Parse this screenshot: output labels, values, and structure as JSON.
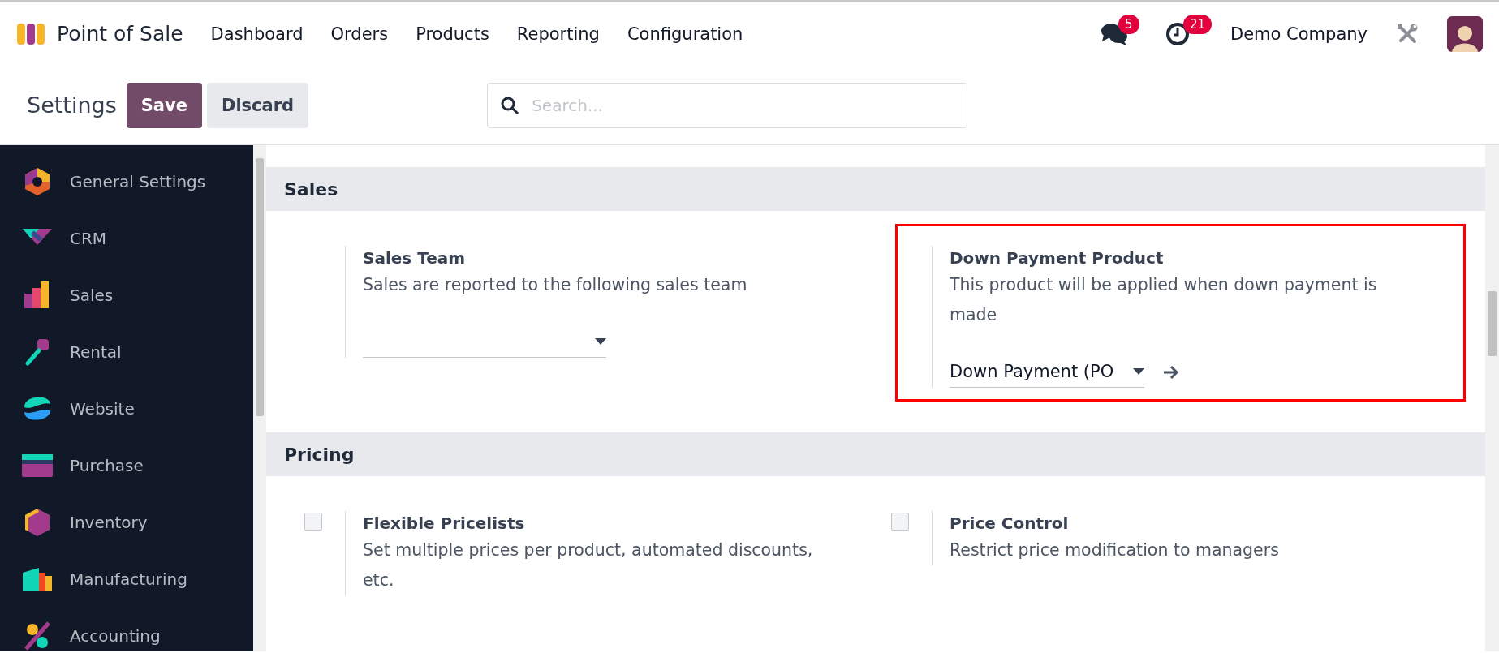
{
  "navbar": {
    "app_name": "Point of Sale",
    "menu": [
      "Dashboard",
      "Orders",
      "Products",
      "Reporting",
      "Configuration"
    ],
    "messages_badge": "5",
    "activities_badge": "21",
    "company": "Demo Company"
  },
  "control_panel": {
    "title": "Settings",
    "save": "Save",
    "discard": "Discard",
    "search": {
      "placeholder": "Search..."
    }
  },
  "sidebar": {
    "items": [
      {
        "label": "General Settings",
        "kind": "general"
      },
      {
        "label": "CRM",
        "kind": "crm"
      },
      {
        "label": "Sales",
        "kind": "sales"
      },
      {
        "label": "Rental",
        "kind": "rental"
      },
      {
        "label": "Website",
        "kind": "website"
      },
      {
        "label": "Purchase",
        "kind": "purchase"
      },
      {
        "label": "Inventory",
        "kind": "inventory"
      },
      {
        "label": "Manufacturing",
        "kind": "manufacturing"
      },
      {
        "label": "Accounting",
        "kind": "accounting"
      }
    ]
  },
  "sections": [
    {
      "title": "Sales",
      "settings": [
        {
          "kind": "field",
          "title": "Sales Team",
          "description": "Sales are reported to the following sales team",
          "highlighted": false,
          "link": false
        },
        {
          "kind": "field",
          "title": "Down Payment Product",
          "description": "This product will be applied when down payment is made",
          "value": "Down Payment (PO",
          "highlighted": true,
          "link": true
        }
      ]
    },
    {
      "title": "Pricing",
      "settings": [
        {
          "kind": "checkbox",
          "title": "Flexible Pricelists",
          "description": "Set multiple prices per product, automated discounts, etc.",
          "checked": false,
          "highlighted": false
        },
        {
          "kind": "checkbox",
          "title": "Price Control",
          "description": "Restrict price modification to managers",
          "checked": false,
          "highlighted": false
        }
      ]
    }
  ]
}
